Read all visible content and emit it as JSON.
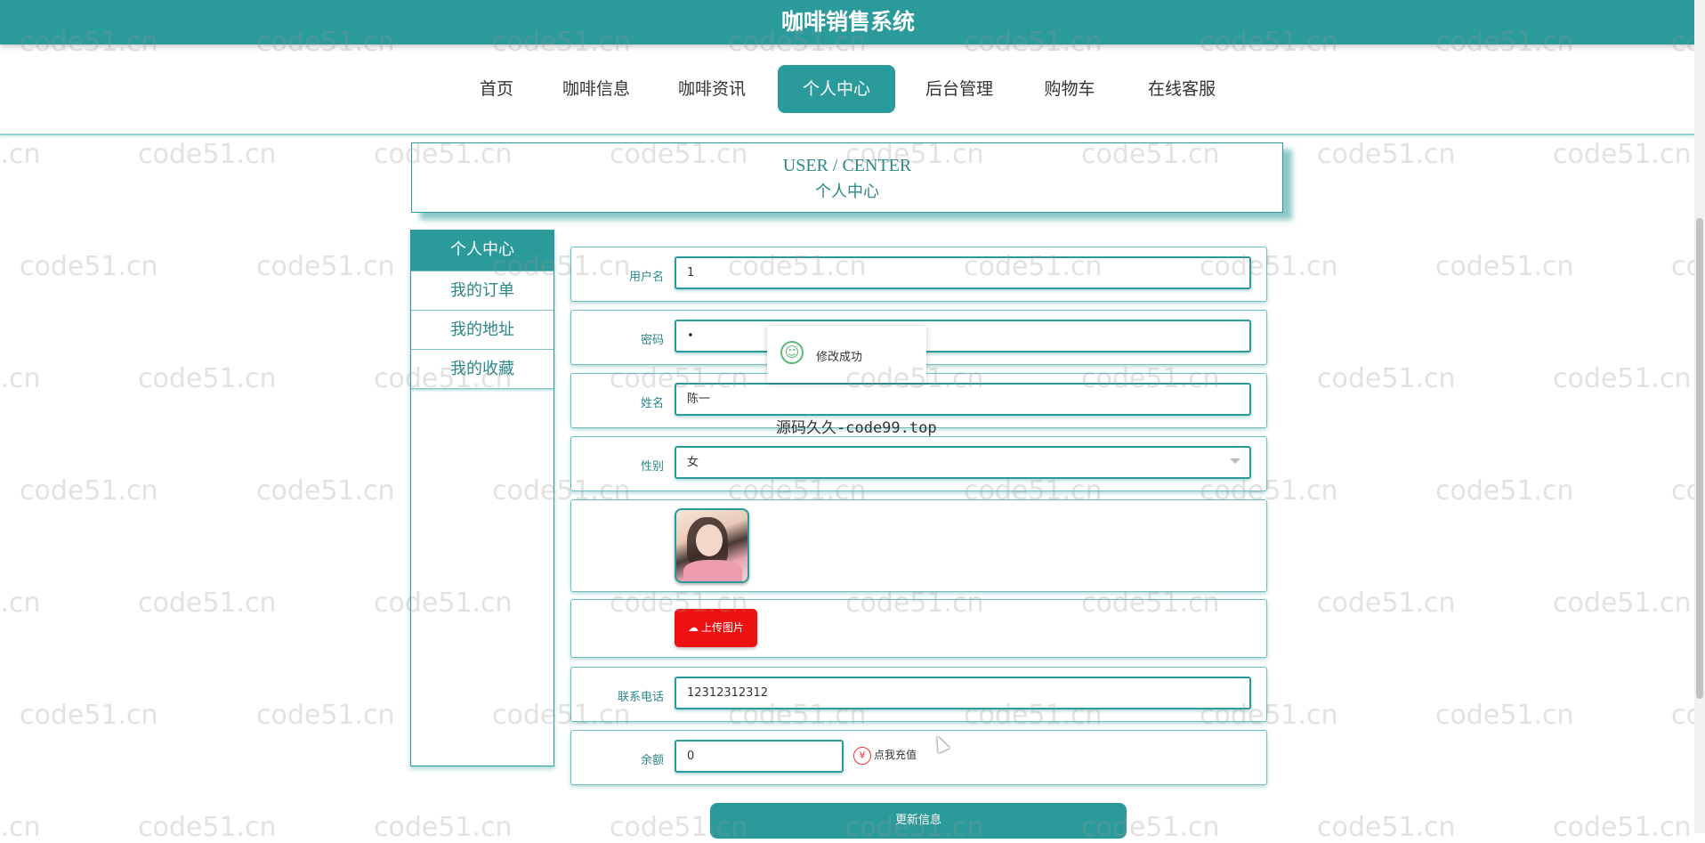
{
  "app": {
    "title": "咖啡销售系统"
  },
  "nav": {
    "items": [
      "首页",
      "咖啡信息",
      "咖啡资讯",
      "个人中心",
      "后台管理",
      "购物车",
      "在线客服"
    ],
    "active_index": 3
  },
  "header": {
    "en": "USER / CENTER",
    "cn": "个人中心"
  },
  "side_menu": {
    "items": [
      "个人中心",
      "我的订单",
      "我的地址",
      "我的收藏"
    ],
    "active_index": 0
  },
  "form": {
    "username": {
      "label": "用户名",
      "value": "1"
    },
    "password": {
      "label": "密码",
      "value": "•"
    },
    "name": {
      "label": "姓名",
      "value": "陈一"
    },
    "gender": {
      "label": "性别",
      "value": "女"
    },
    "upload_label": "上传图片",
    "phone": {
      "label": "联系电话",
      "value": "12312312312"
    },
    "balance": {
      "label": "余额",
      "value": "0",
      "recharge_text": "点我充值"
    },
    "submit_label": "更新信息"
  },
  "toast": {
    "message": "修改成功",
    "icon": "smile-icon"
  },
  "overlay_text": "源码久久-code99.top",
  "watermark": "code51.cn",
  "colors": {
    "primary": "#2b9a9a",
    "upload_red": "#ee1111",
    "success_green": "#5fb878"
  }
}
